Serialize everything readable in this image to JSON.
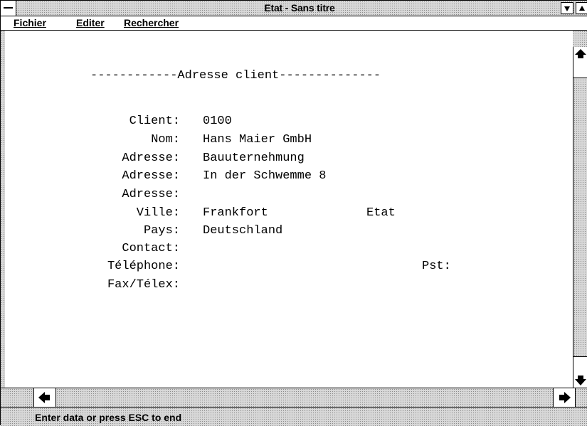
{
  "window": {
    "title": "Etat - Sans titre"
  },
  "menubar": {
    "items": [
      {
        "label": "Fichier"
      },
      {
        "label": "Editer"
      },
      {
        "label": "Rechercher"
      }
    ]
  },
  "form": {
    "heading": "------------Adresse client--------------",
    "fields": {
      "client": {
        "label": "Client:",
        "value": "0100"
      },
      "nom": {
        "label": "Nom:",
        "value": "Hans Maier GmbH"
      },
      "adresse1": {
        "label": "Adresse:",
        "value": "Bauuternehmung"
      },
      "adresse2": {
        "label": "Adresse:",
        "value": "In der Schwemme 8"
      },
      "adresse3": {
        "label": "Adresse:",
        "value": ""
      },
      "ville": {
        "label": "Ville:",
        "value": "Frankfort",
        "etat_label": "Etat"
      },
      "pays": {
        "label": "Pays:",
        "value": "Deutschland"
      },
      "contact": {
        "label": "Contact:",
        "value": ""
      },
      "telephone": {
        "label": "Téléphone:",
        "value": "",
        "pst_label": "Pst:"
      },
      "fax": {
        "label": "Fax/Télex:",
        "value": ""
      }
    }
  },
  "status": {
    "text": "Enter data or press ESC to end"
  },
  "icons": [
    "system-menu-icon",
    "minimize-icon",
    "maximize-icon",
    "scroll-up-icon",
    "scroll-down-icon",
    "scroll-left-icon",
    "scroll-right-icon"
  ]
}
